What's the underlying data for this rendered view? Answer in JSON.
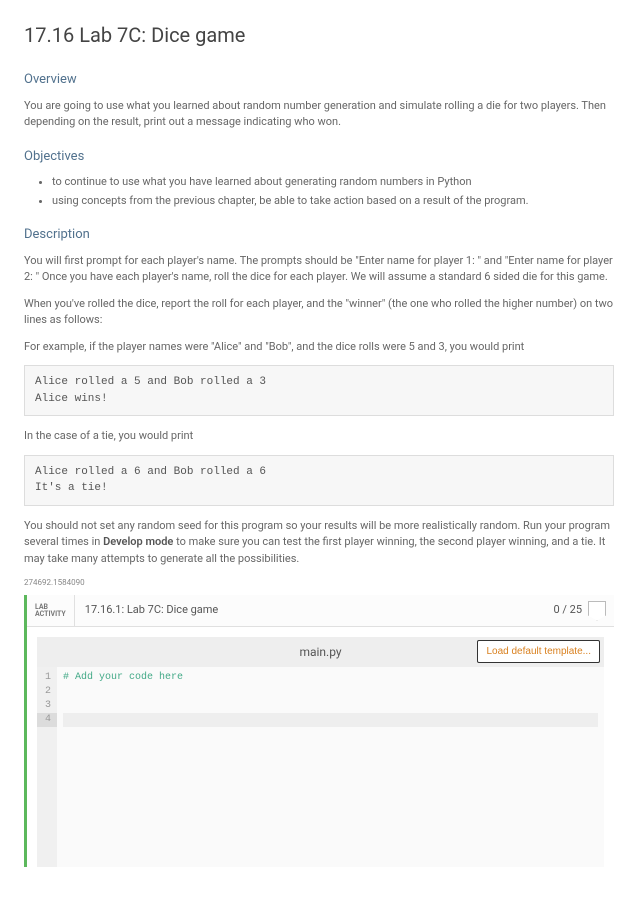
{
  "title": "17.16 Lab 7C: Dice game",
  "sections": {
    "overview": {
      "heading": "Overview",
      "text": "You are going to use what you learned about random number generation and simulate rolling a die for two players. Then depending on the result, print out a message indicating who won."
    },
    "objectives": {
      "heading": "Objectives",
      "items": [
        "to continue to use what you have learned about generating random numbers in Python",
        "using concepts from the previous chapter, be able to take action based on a result of the program."
      ]
    },
    "description": {
      "heading": "Description",
      "p1": "You will first prompt for each player's name. The prompts should be \"Enter name for player 1: \" and \"Enter name for player 2: \" Once you have each player's name, roll the dice for each player. We will assume a standard 6 sided die for this game.",
      "p2": "When you've rolled the dice, report the roll for each player, and the \"winner\" (the one who rolled the higher number) on two lines as follows:",
      "p3": "For example, if the player names were \"Alice\" and \"Bob\", and the dice rolls were 5 and 3, you would print",
      "code1": "Alice rolled a 5 and Bob rolled a 3\nAlice wins!",
      "p4": "In the case of a tie, you would print",
      "code2": "Alice rolled a 6 and Bob rolled a 6\nIt's a tie!",
      "p5_pre": "You should not set any random seed for this program so your results will be more realistically random. Run your program several times in ",
      "p5_bold": "Develop mode",
      "p5_post": " to make sure you can test the first player winning, the second player winning, and a tie. It may take many attempts to generate all the possibilities."
    }
  },
  "small_id": "274692.1584090",
  "lab": {
    "tag1": "LAB",
    "tag2": "ACTIVITY",
    "title": "17.16.1: Lab 7C: Dice game",
    "score": "0 / 25",
    "filename": "main.py",
    "load_button": "Load default template...",
    "gutter": [
      "1",
      "2",
      "3",
      "4"
    ],
    "code_line1": "# Add your code here"
  }
}
